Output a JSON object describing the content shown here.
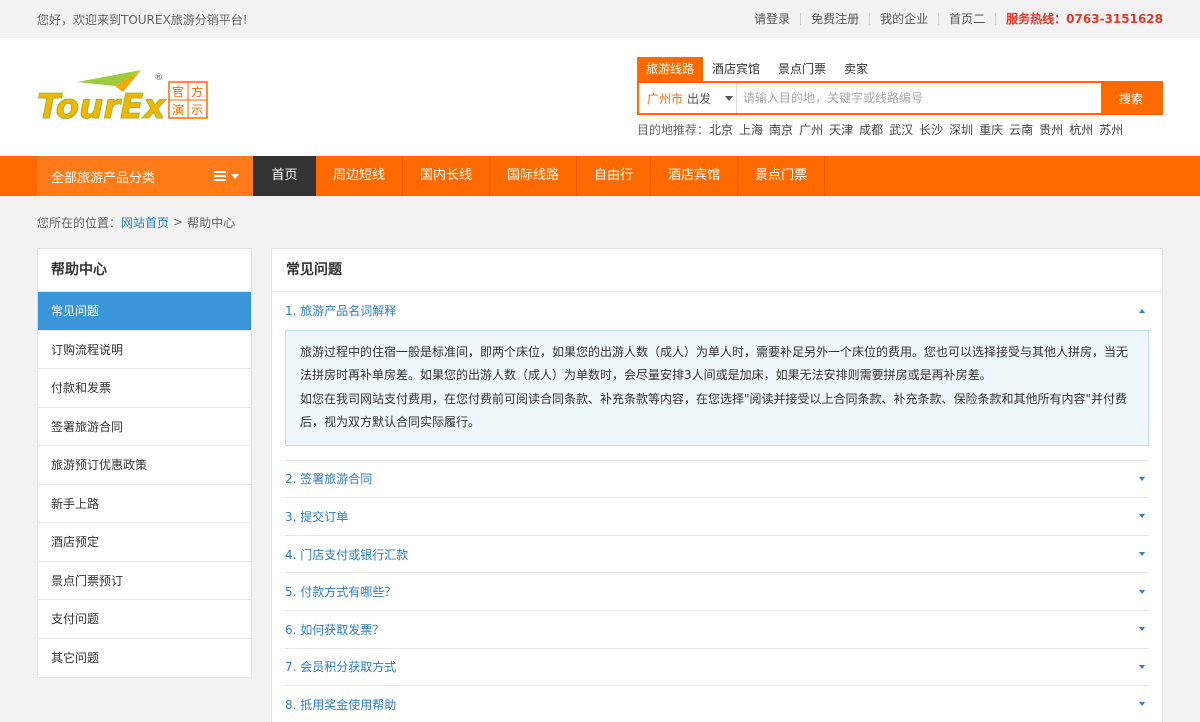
{
  "topbar": {
    "welcome": "您好，欢迎来到TOUREX旅游分销平台!",
    "links": [
      "请登录",
      "免费注册",
      "我的企业",
      "首页二"
    ],
    "hotline_label": "服务热线：",
    "hotline_number": "0763-3151628"
  },
  "logo": {
    "text": "TourEx",
    "badge": [
      "官",
      "方",
      "演",
      "示"
    ],
    "reg": "®"
  },
  "search": {
    "tabs": [
      "旅游线路",
      "酒店宾馆",
      "景点门票",
      "卖家"
    ],
    "city": "广州市",
    "depart": "出发",
    "placeholder": "请输入目的地，关键字或线路编号",
    "button": "搜索",
    "recommend_label": "目的地推荐：",
    "cities": [
      "北京",
      "上海",
      "南京",
      "广州",
      "天津",
      "成都",
      "武汉",
      "长沙",
      "深圳",
      "重庆",
      "云南",
      "贵州",
      "杭州",
      "苏州"
    ]
  },
  "nav": {
    "all_categories": "全部旅游产品分类",
    "items": [
      "首页",
      "周边短线",
      "国内长线",
      "国际线路",
      "自由行",
      "酒店宾馆",
      "景点门票"
    ]
  },
  "breadcrumb": {
    "label": "您所在的位置：",
    "home": "网站首页",
    "sep": ">",
    "current": "帮助中心"
  },
  "sidebar": {
    "title": "帮助中心",
    "items": [
      "常见问题",
      "订购流程说明",
      "付款和发票",
      "签署旅游合同",
      "旅游预订优惠政策",
      "新手上路",
      "酒店预定",
      "景点门票预订",
      "支付问题",
      "其它问题"
    ]
  },
  "content": {
    "title": "常见问题",
    "open_question": "1. 旅游产品名词解释",
    "answer_p1": "旅游过程中的住宿一般是标准间，即两个床位，如果您的出游人数（成人）为单人时，需要补足另外一个床位的费用。您也可以选择接受与其他人拼房，当无法拼房时再补单房差。如果您的出游人数（成人）为单数时，会尽量安排3人间或是加床，如果无法安排则需要拼房或是再补房差。",
    "answer_p2": "如您在我司网站支付费用，在您付费前可阅读合同条款、补充条款等内容，在您选择\"阅读并接受以上合同条款、补充条款、保险条款和其他所有内容\"并付费后，视为双方默认合同实际履行。",
    "questions": [
      "2. 签署旅游合同",
      "3. 提交订单",
      "4. 门店支付或银行汇款",
      "5. 付款方式有哪些？",
      "6. 如何获取发票？",
      "7. 会员积分获取方式",
      "8. 抵用奖金使用帮助"
    ]
  },
  "colors": {
    "accent": "#ff6a00",
    "link": "#2e7ec4",
    "active_side": "#3a95d9",
    "hotline": "#e8352b"
  }
}
